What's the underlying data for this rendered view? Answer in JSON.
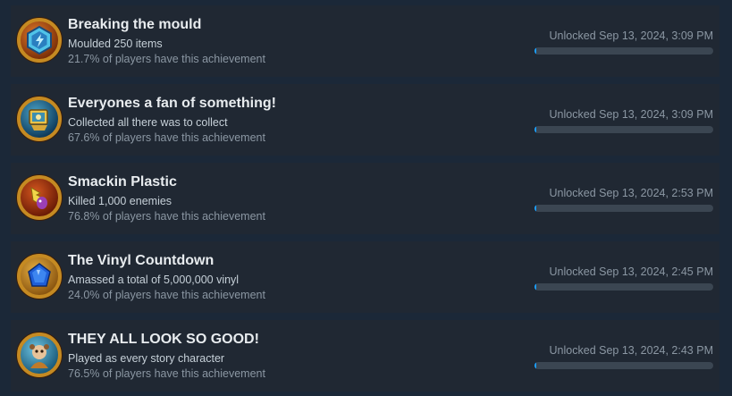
{
  "achievements": [
    {
      "title": "Breaking the mould",
      "description": "Moulded 250 items",
      "rarity": "21.7% of players have this achievement",
      "unlocked": "Unlocked Sep 13, 2024, 3:09 PM",
      "icon": "hexagon-mould-icon",
      "progress": 1.0
    },
    {
      "title": "Everyones a fan of something!",
      "description": "Collected all there was to collect",
      "rarity": "67.6% of players have this achievement",
      "unlocked": "Unlocked Sep 13, 2024, 3:09 PM",
      "icon": "collectible-card-icon",
      "progress": 1.0
    },
    {
      "title": "Smackin Plastic",
      "description": "Killed 1,000 enemies",
      "rarity": "76.8% of players have this achievement",
      "unlocked": "Unlocked Sep 13, 2024, 2:53 PM",
      "icon": "plastic-creature-icon",
      "progress": 1.0
    },
    {
      "title": "The Vinyl Countdown",
      "description": "Amassed a total of 5,000,000 vinyl",
      "rarity": "24.0% of players have this achievement",
      "unlocked": "Unlocked Sep 13, 2024, 2:45 PM",
      "icon": "blue-gem-icon",
      "progress": 1.0
    },
    {
      "title": "THEY ALL LOOK SO GOOD!",
      "description": "Played as every story character",
      "rarity": "76.5% of players have this achievement",
      "unlocked": "Unlocked Sep 13, 2024, 2:43 PM",
      "icon": "character-portrait-icon",
      "progress": 1.0
    }
  ],
  "colors": {
    "background": "#1b2838",
    "row": "#202833",
    "progress_fill": "#1a9fff",
    "progress_track": "#3b4652",
    "icon_rim": "#c58a22"
  }
}
